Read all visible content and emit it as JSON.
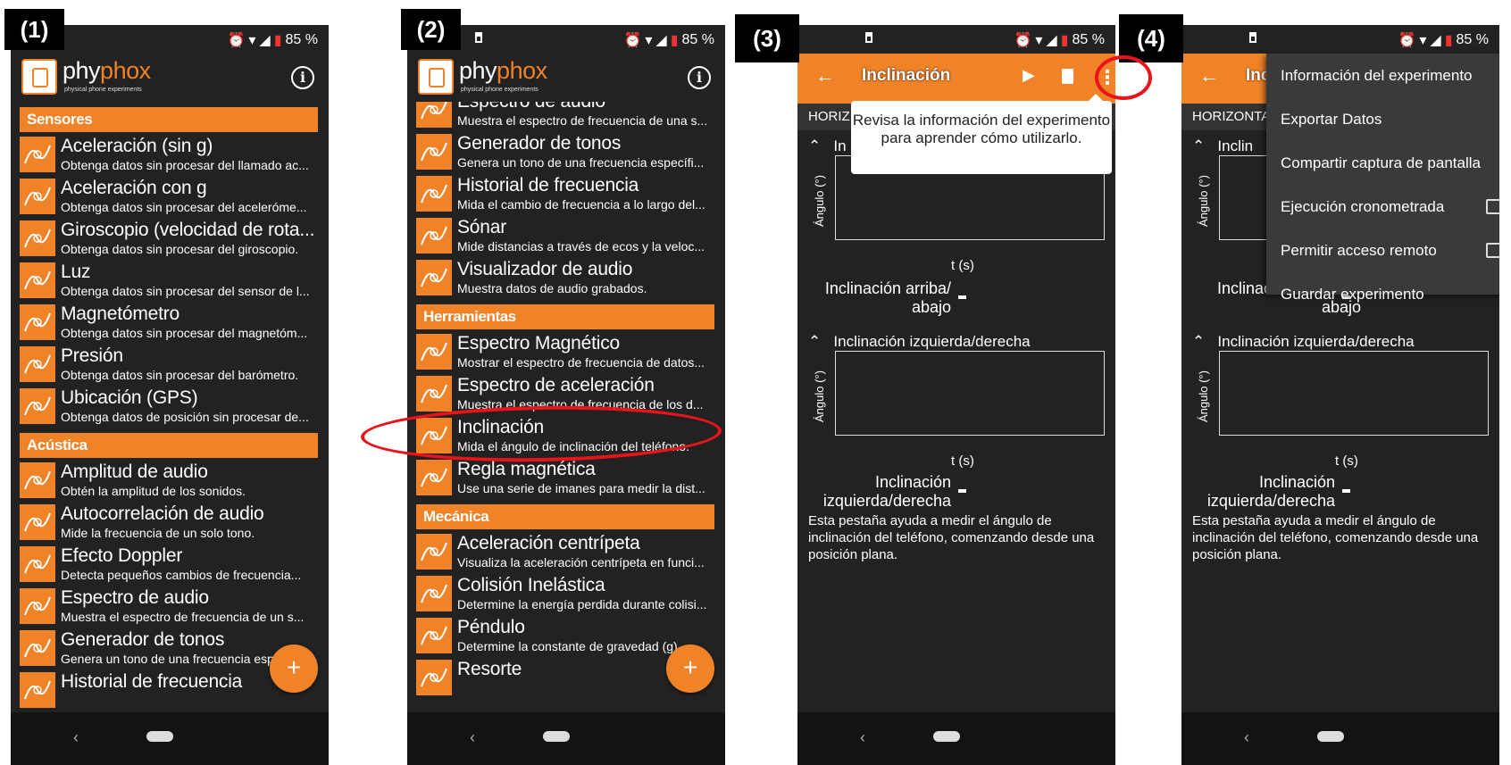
{
  "labels": {
    "p1": "(1)",
    "p2": "(2)",
    "p3": "(3)",
    "p4": "(4)"
  },
  "status": {
    "battery": "85 %"
  },
  "brand": {
    "name_a": "phy",
    "name_b": "phox",
    "tagline": "physical phone experiments"
  },
  "screen1": {
    "categories": [
      "Sensores",
      "Acústica"
    ],
    "sensores": [
      {
        "title": "Aceleración (sin g)",
        "sub": "Obtenga datos sin procesar del llamado ac...",
        "icon": "acceleration-icon"
      },
      {
        "title": "Aceleración con g",
        "sub": "Obtenga datos sin procesar del aceleróme...",
        "icon": "acceleration-g-icon"
      },
      {
        "title": "Giroscopio (velocidad de rota...",
        "sub": "Obtenga datos sin procesar del giroscopio.",
        "icon": "gyroscope-icon"
      },
      {
        "title": "Luz",
        "sub": "Obtenga datos sin procesar del sensor de l...",
        "icon": "light-bulb-icon"
      },
      {
        "title": "Magnetómetro",
        "sub": "Obtenga datos sin procesar del magnetóm...",
        "icon": "magnet-icon"
      },
      {
        "title": "Presión",
        "sub": "Obtenga datos sin procesar del barómetro.",
        "icon": "pressure-icon"
      },
      {
        "title": "Ubicación (GPS)",
        "sub": "Obtenga datos de posición sin procesar de...",
        "icon": "gps-icon"
      }
    ],
    "acustica": [
      {
        "title": "Amplitud de audio",
        "sub": "Obtén la amplitud de los sonidos.",
        "icon": "sine-wave-icon"
      },
      {
        "title": "Autocorrelación de audio",
        "sub": "Mide la frecuencia de un solo tono.",
        "icon": "autocorrelation-icon"
      },
      {
        "title": "Efecto Doppler",
        "sub": "Detecta pequeños cambios de frecuencia...",
        "icon": "doppler-icon"
      },
      {
        "title": "Espectro de audio",
        "sub": "Muestra el espectro de frecuencia de un s...",
        "icon": "spectrum-icon"
      },
      {
        "title": "Generador de tonos",
        "sub": "Genera un tono de una frecuencia específ...",
        "icon": "speaker-icon"
      },
      {
        "title": "Historial de frecuencia",
        "sub": "",
        "icon": "history-icon"
      }
    ]
  },
  "screen2": {
    "categories": [
      "Herramientas",
      "Mecánica"
    ],
    "top": [
      {
        "title": "Espectro de audio",
        "sub": "Muestra el espectro de frecuencia de una s...",
        "icon": "spectrum-icon"
      },
      {
        "title": "Generador de tonos",
        "sub": "Genera un tono de una frecuencia específi...",
        "icon": "speaker-icon"
      },
      {
        "title": "Historial de frecuencia",
        "sub": "Mida el cambio de frecuencia a lo largo del...",
        "icon": "history-icon"
      },
      {
        "title": "Sónar",
        "sub": "Mide distancias a través de ecos y la veloc...",
        "icon": "sonar-icon"
      },
      {
        "title": "Visualizador de audio",
        "sub": "Muestra datos de audio grabados.",
        "icon": "audio-wave-icon"
      }
    ],
    "herramientas": [
      {
        "title": "Espectro Magnético",
        "sub": "Mostrar el espectro de frecuencia de datos...",
        "icon": "magnet-spectrum-icon"
      },
      {
        "title": "Espectro de aceleración",
        "sub": "Muestra el espectro de frecuencia de los d...",
        "icon": "acc-spectrum-icon"
      },
      {
        "title": "Inclinación",
        "sub": "Mida el ángulo de inclinación del teléfono.",
        "icon": "inclination-icon"
      },
      {
        "title": "Regla magnética",
        "sub": "Use una serie de imanes para medir la dist...",
        "icon": "ruler-icon"
      }
    ],
    "mecanica": [
      {
        "title": "Aceleración centrípeta",
        "sub": "Visualiza la aceleración centrípeta en funci...",
        "icon": "centripetal-icon"
      },
      {
        "title": "Colisión Inelástica",
        "sub": "Determine la energía perdida durante colisi...",
        "icon": "collision-icon"
      },
      {
        "title": "Péndulo",
        "sub": "Determine la constante de gravedad (g)...",
        "icon": "pendulum-icon"
      },
      {
        "title": "Resorte",
        "sub": "",
        "icon": "spring-icon"
      }
    ]
  },
  "experiment": {
    "title": "Inclinación",
    "tab": "HORIZONTAL",
    "tab_short": "HORIZ",
    "tab_mid": "HORIZONTA",
    "section1": "Inclinación arriba/abajo",
    "section1_short": "In",
    "section1_mid": "Inclin",
    "section2": "Inclinación izquierda/derecha",
    "ylabel": "Ángulo (°)",
    "xlabel": "t (s)",
    "val1_a": "Inclinación arriba/",
    "val1_b": "abajo",
    "val1_mid": "Inclinaci",
    "val2_a": "Inclinación",
    "val2_b": "izquierda/derecha",
    "value": "-",
    "description": "Esta pestaña ayuda a medir el ángulo de inclinación del teléfono, comenzando desde una posición plana.",
    "tooltip": "Revisa la información del experimento para aprender cómo utilizarlo."
  },
  "menu": {
    "items": [
      "Información del experimento",
      "Exportar Datos",
      "Compartir captura de pantalla",
      "Ejecución cronometrada",
      "Permitir acceso remoto",
      "Guardar experimento"
    ]
  },
  "fab_label": "+",
  "colors": {
    "accent": "#f08228",
    "highlight": "#e8141a",
    "background": "#222222"
  }
}
